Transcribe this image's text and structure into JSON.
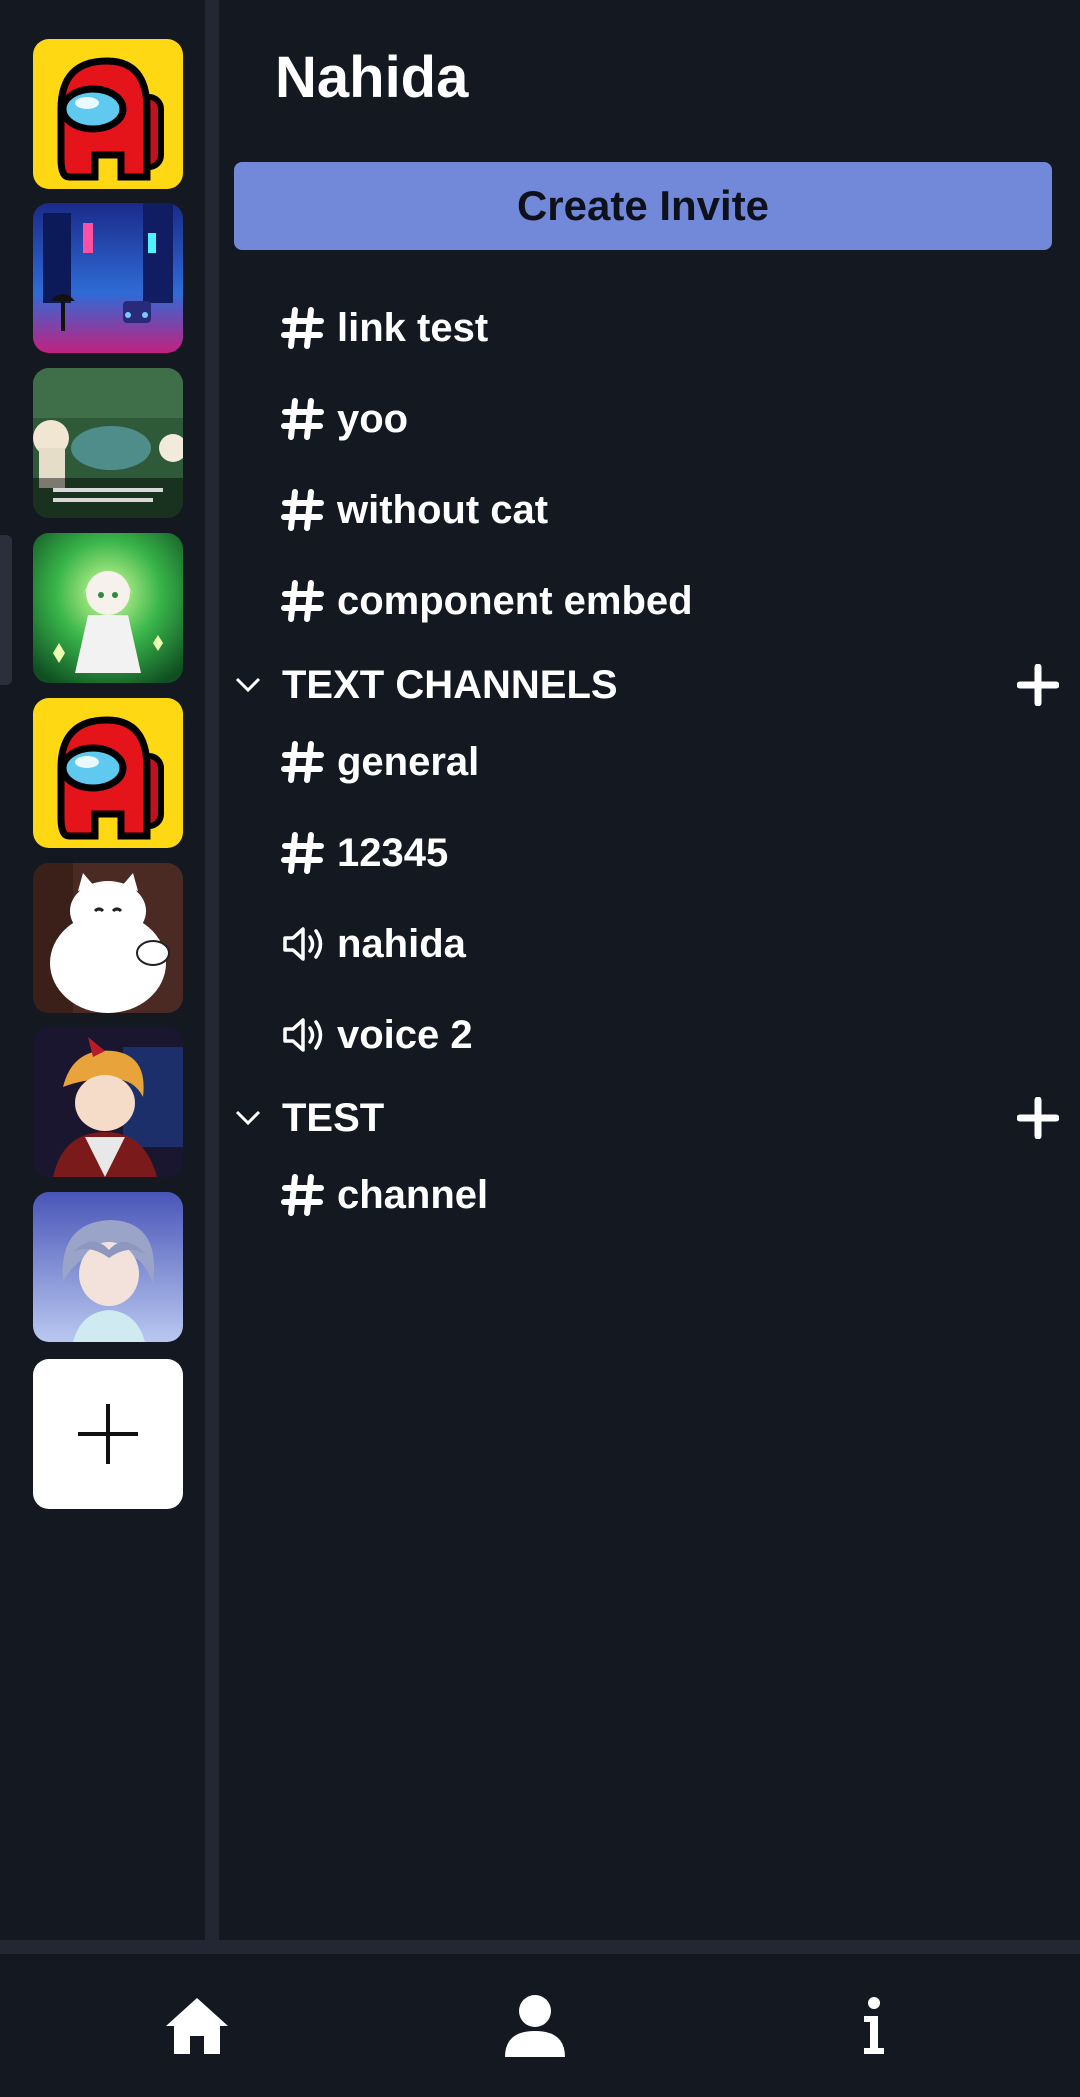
{
  "server_list": {
    "servers": [
      {
        "name": "among-us-server",
        "icon": "among-us-icon"
      },
      {
        "name": "neon-city-server",
        "icon": "neon-city-icon"
      },
      {
        "name": "game-clip-server",
        "icon": "game-clip-icon"
      },
      {
        "name": "nahida-server",
        "icon": "nahida-icon",
        "selected": true
      },
      {
        "name": "among-us-server-2",
        "icon": "among-us-icon"
      },
      {
        "name": "cat-server",
        "icon": "cat-icon"
      },
      {
        "name": "shorts-server",
        "icon": "anime-boy-icon"
      },
      {
        "name": "anime-server",
        "icon": "anime-girl-icon"
      }
    ],
    "add_server_icon": "plus-icon"
  },
  "channel_panel": {
    "server_name": "Nahida",
    "create_invite_label": "Create Invite",
    "uncategorized_channels": [
      {
        "label": "link test",
        "type": "text"
      },
      {
        "label": "yoo",
        "type": "text"
      },
      {
        "label": "without cat",
        "type": "text"
      },
      {
        "label": "component embed",
        "type": "text"
      }
    ],
    "categories": [
      {
        "label": "TEXT CHANNELS",
        "channels": [
          {
            "label": "general",
            "type": "text"
          },
          {
            "label": "12345",
            "type": "text"
          },
          {
            "label": "nahida",
            "type": "voice"
          },
          {
            "label": "voice 2",
            "type": "voice"
          }
        ]
      },
      {
        "label": "TEST",
        "channels": [
          {
            "label": "channel",
            "type": "text"
          }
        ]
      }
    ]
  },
  "bottom_nav": {
    "items": [
      {
        "name": "home",
        "icon": "home-icon"
      },
      {
        "name": "profile",
        "icon": "user-icon"
      },
      {
        "name": "info",
        "icon": "info-icon"
      }
    ]
  },
  "colors": {
    "background": "#141821",
    "divider": "#232734",
    "accent": "#7289da",
    "text": "#ffffff"
  }
}
